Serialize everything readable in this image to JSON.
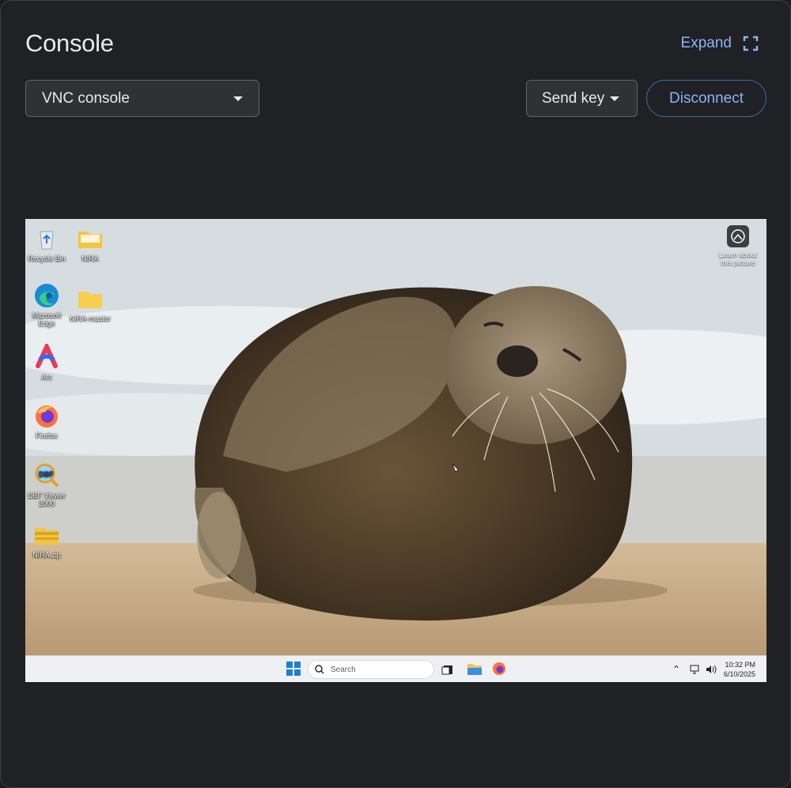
{
  "header": {
    "title": "Console",
    "expand_label": "Expand"
  },
  "toolbar": {
    "console_select_value": "VNC console",
    "send_key_label": "Send key",
    "disconnect_label": "Disconnect"
  },
  "remote_desktop": {
    "desktop_icons": [
      {
        "label": "Recycle Bin",
        "icon": "recycle-bin-icon"
      },
      {
        "label": "NIRA",
        "icon": "folder-icon"
      },
      {
        "label": "Microsoft Edge",
        "icon": "edge-icon"
      },
      {
        "label": "NIRA-master",
        "icon": "folder-icon"
      },
      {
        "label": "Arc",
        "icon": "arc-icon"
      },
      {
        "label": "Firefox",
        "icon": "firefox-icon"
      },
      {
        "label": "DBF Viewer 2000",
        "icon": "dbf-viewer-icon"
      },
      {
        "label": "NIRA.zip",
        "icon": "zip-folder-icon"
      }
    ],
    "learn_label": "Learn about this picture",
    "taskbar": {
      "search_placeholder": "Search",
      "time": "10:32 PM",
      "date": "6/10/2025"
    }
  },
  "colors": {
    "accent": "#8ab4f8",
    "panel_bg": "#202124",
    "control_bg": "#303134"
  }
}
